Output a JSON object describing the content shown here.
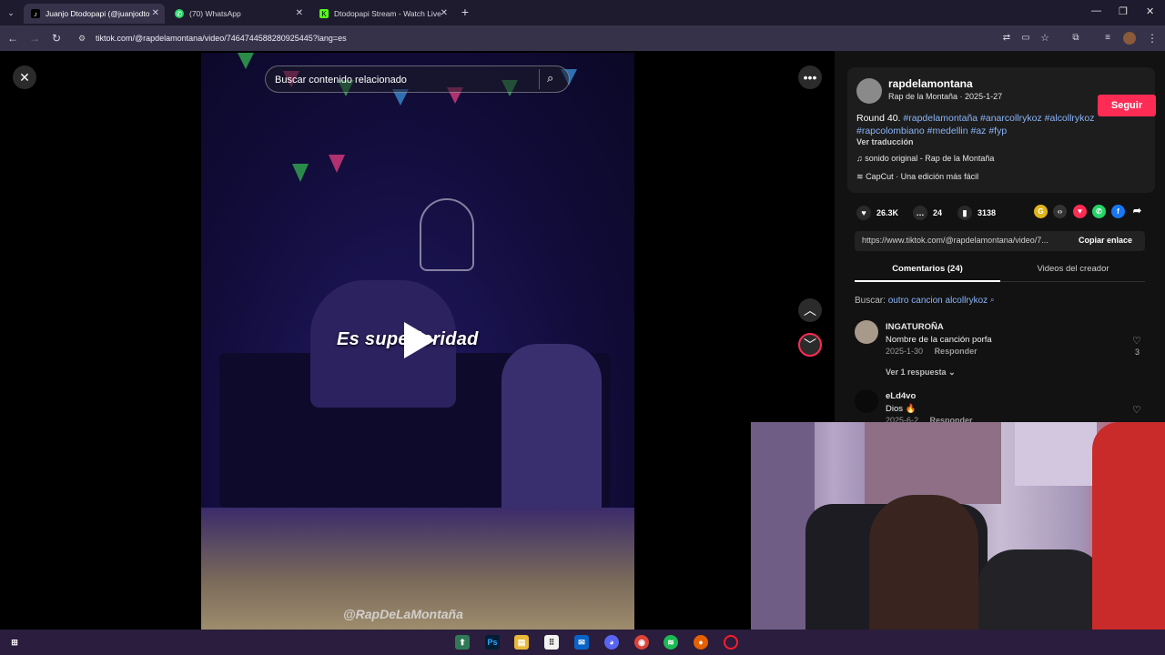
{
  "browser": {
    "tabs": [
      {
        "label": "Juanjo Dtodopapi (@juanjodto",
        "active": true
      },
      {
        "label": "(70) WhatsApp",
        "active": false
      },
      {
        "label": "Dtodopapi Stream - Watch Live",
        "active": false
      }
    ],
    "new_tab": "+",
    "url": "tiktok.com/@rapdelamontana/video/7464744588280925445?lang=es"
  },
  "video": {
    "search_placeholder": "Buscar contenido relacionado",
    "caption": "Es superioridad",
    "watermark": "@RapDeLaMontaña"
  },
  "post": {
    "username": "rapdelamontana",
    "subline": "Rap de la Montaña · 2025-1-27",
    "follow_label": "Seguir",
    "description_prefix": "Round 40.",
    "hashtags_line1": "#rapdelamontaña #anarcollrykoz #alcollrykoz",
    "hashtags_line2": "#rapcolombiano #medellin #az #fyp",
    "translate": "Ver traducción",
    "sound": "sonido original - Rap de la Montaña",
    "capcut": "CapCut · Una edición más fácil",
    "likes": "26.3K",
    "comments": "24",
    "saves": "3138",
    "link": "https://www.tiktok.com/@rapdelamontana/video/7...",
    "copy_label": "Copiar enlace"
  },
  "panel_tabs": {
    "comments": "Comentarios (24)",
    "creator_videos": "Videos del creador"
  },
  "search_suggest": {
    "prefix": "Buscar:",
    "query": "outro cancion alcollrykoz"
  },
  "comments": [
    {
      "name": "INGATUROÑA",
      "text": "Nombre de la canción porfa",
      "date": "2025-1-30",
      "reply": "Responder",
      "likes": "3",
      "view_replies": "Ver 1 respuesta"
    },
    {
      "name": "eLd4vo",
      "text": "Dios 🔥",
      "date": "2025-6-2",
      "reply": "Responder"
    }
  ],
  "colors": {
    "accent": "#fe2c55",
    "hashtag": "#8ab4f8",
    "taskbar": "#2b1d3d"
  }
}
